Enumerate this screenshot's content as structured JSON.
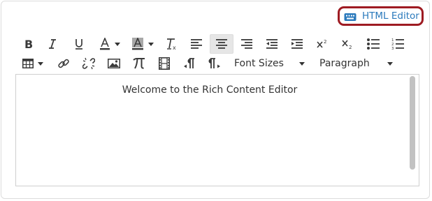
{
  "header": {
    "html_editor_label": "HTML Editor",
    "html_editor_icon": "keyboard-icon",
    "accent_color": "#2b7abc",
    "highlight_color": "#9e1b22"
  },
  "toolbar": {
    "row1": [
      {
        "name": "bold",
        "icon": "bold-icon"
      },
      {
        "name": "italic",
        "icon": "italic-icon"
      },
      {
        "name": "underline",
        "icon": "underline-icon"
      },
      {
        "name": "text-color",
        "icon": "text-color-icon"
      },
      {
        "name": "background-color",
        "icon": "background-color-icon"
      },
      {
        "name": "clear-formatting",
        "icon": "clear-formatting-icon"
      },
      {
        "name": "align-left",
        "icon": "align-left-icon"
      },
      {
        "name": "align-center",
        "icon": "align-center-icon",
        "active": true
      },
      {
        "name": "align-right",
        "icon": "align-right-icon"
      },
      {
        "name": "outdent",
        "icon": "outdent-icon"
      },
      {
        "name": "indent",
        "icon": "indent-icon"
      },
      {
        "name": "superscript",
        "icon": "superscript-icon"
      },
      {
        "name": "subscript",
        "icon": "subscript-icon"
      },
      {
        "name": "bullet-list",
        "icon": "bullet-list-icon"
      },
      {
        "name": "numbered-list",
        "icon": "numbered-list-icon"
      }
    ],
    "row2": [
      {
        "name": "table",
        "icon": "table-icon"
      },
      {
        "name": "link",
        "icon": "link-icon"
      },
      {
        "name": "unlink",
        "icon": "unlink-icon"
      },
      {
        "name": "image",
        "icon": "image-icon"
      },
      {
        "name": "math",
        "icon": "pi-icon"
      },
      {
        "name": "media",
        "icon": "film-icon"
      },
      {
        "name": "ltr",
        "icon": "ltr-paragraph-icon"
      },
      {
        "name": "rtl",
        "icon": "rtl-paragraph-icon"
      }
    ],
    "font_sizes_label": "Font Sizes",
    "paragraph_label": "Paragraph"
  },
  "editor": {
    "content": "Welcome to the Rich Content Editor"
  }
}
